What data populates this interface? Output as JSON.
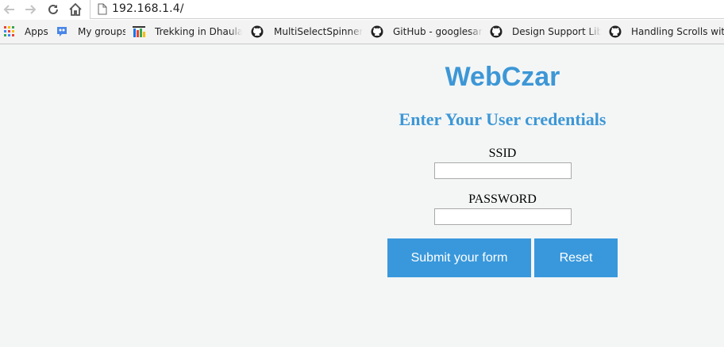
{
  "browser": {
    "url": "192.168.1.4/",
    "bookmarks": [
      {
        "label": "Apps",
        "icon": "apps-grid-icon"
      },
      {
        "label": "My groups",
        "icon": "groups-icon"
      },
      {
        "label": "Trekking in Dhauladh",
        "icon": "trekking-icon"
      },
      {
        "label": "MultiSelectSpinner/s",
        "icon": "github-icon"
      },
      {
        "label": "GitHub - googlesam",
        "icon": "github-icon"
      },
      {
        "label": "Design Support Libra",
        "icon": "github-icon"
      },
      {
        "label": "Handling Scrolls with",
        "icon": "github-icon"
      }
    ]
  },
  "page": {
    "title": "WebCzar",
    "subtitle": "Enter Your User credentials",
    "ssid_label": "SSID",
    "ssid_value": "",
    "password_label": "PASSWORD",
    "password_value": "",
    "submit_label": "Submit your form",
    "reset_label": "Reset"
  },
  "colors": {
    "accent": "#3d97d6",
    "button": "#3998dc",
    "page_bg": "#f4f6f6"
  }
}
